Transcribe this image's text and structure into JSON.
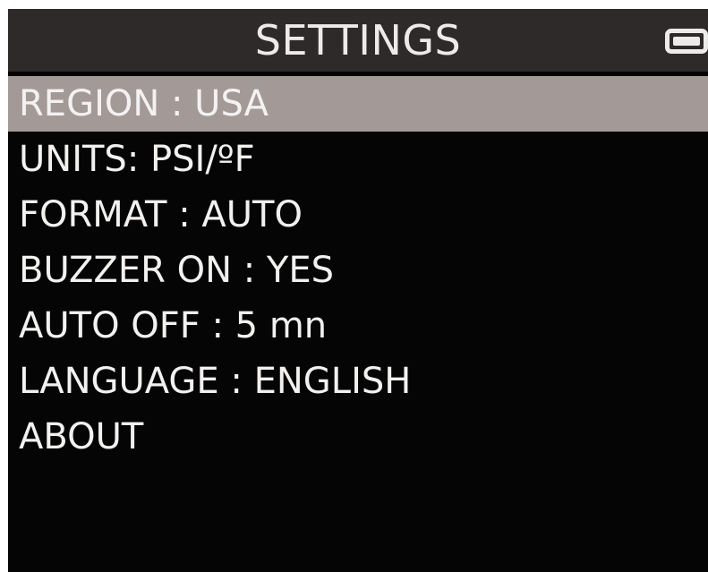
{
  "header": {
    "title": "SETTINGS",
    "battery_icon": "battery-full-icon"
  },
  "menu": {
    "items": [
      {
        "label": "REGION : USA",
        "selected": true
      },
      {
        "label": "UNITS: PSI/ºF",
        "selected": false
      },
      {
        "label": "FORMAT : AUTO",
        "selected": false
      },
      {
        "label": "BUZZER ON : YES",
        "selected": false
      },
      {
        "label": "AUTO OFF : 5 mn",
        "selected": false
      },
      {
        "label": "LANGUAGE : ENGLISH",
        "selected": false
      },
      {
        "label": "ABOUT",
        "selected": false
      }
    ]
  },
  "colors": {
    "screen_background": "#050505",
    "title_bar": "#2d2a29",
    "selection_highlight": "#a39a98",
    "text": "#f2f1f0"
  }
}
